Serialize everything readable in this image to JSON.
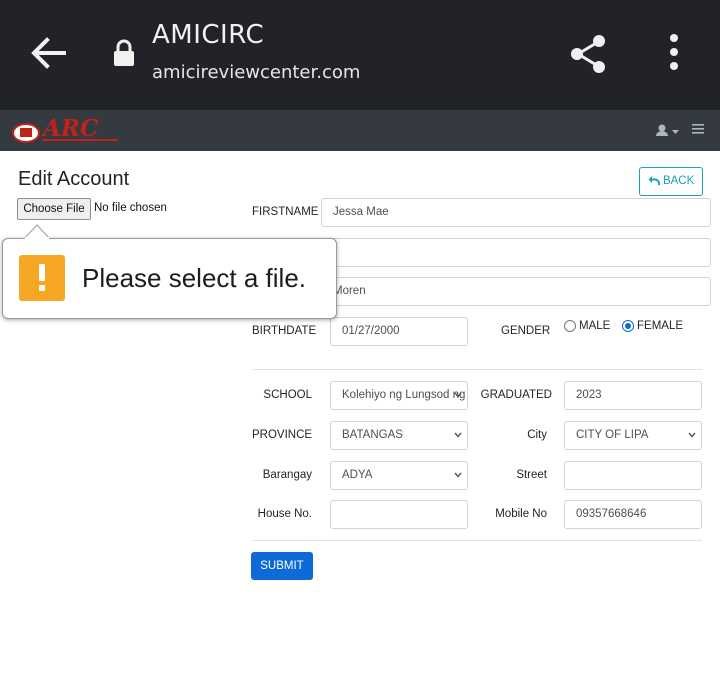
{
  "browser": {
    "site_title": "AMICIRC",
    "site_url": "amicireviewcenter.com"
  },
  "navbar": {
    "logo_text": "ARC"
  },
  "page": {
    "title": "Edit Account",
    "back_label": "BACK",
    "file_input": {
      "button_label": "Choose File",
      "status": "No file chosen"
    }
  },
  "form": {
    "firstname": {
      "label": "FIRSTNAME",
      "value": "Jessa Mae"
    },
    "middlename": {
      "label": "",
      "value": ""
    },
    "lastname": {
      "label": "",
      "value": "Moren"
    },
    "birthdate": {
      "label": "BIRTHDATE",
      "value": "01/27/2000"
    },
    "gender": {
      "label": "GENDER",
      "options": [
        "MALE",
        "FEMALE"
      ],
      "selected": "FEMALE"
    },
    "school": {
      "label": "SCHOOL",
      "value": "Kolehiyo ng Lungsod ng Lipa"
    },
    "graduated": {
      "label": "GRADUATED",
      "value": "2023"
    },
    "province": {
      "label": "PROVINCE",
      "value": "BATANGAS"
    },
    "city": {
      "label": "City",
      "value": "CITY OF LIPA"
    },
    "barangay": {
      "label": "Barangay",
      "value": "ADYA"
    },
    "street": {
      "label": "Street",
      "value": ""
    },
    "house_no": {
      "label": "House No.",
      "value": ""
    },
    "mobile_no": {
      "label": "Mobile No",
      "value": "09357668646"
    },
    "submit_label": "SUBMIT"
  },
  "tooltip": {
    "message": "Please select a file."
  },
  "colors": {
    "browser_bar": "#212328",
    "navbar": "#343a40",
    "primary": "#0d6ad6",
    "info": "#17a2b8",
    "warning": "#f5a623",
    "logo_red": "#c0221c"
  },
  "icons": [
    "back-arrow-icon",
    "lock-icon",
    "share-icon",
    "more-vert-icon",
    "user-icon",
    "caret-down-icon",
    "hamburger-icon",
    "undo-icon",
    "warning-icon",
    "chevron-down-icon"
  ]
}
